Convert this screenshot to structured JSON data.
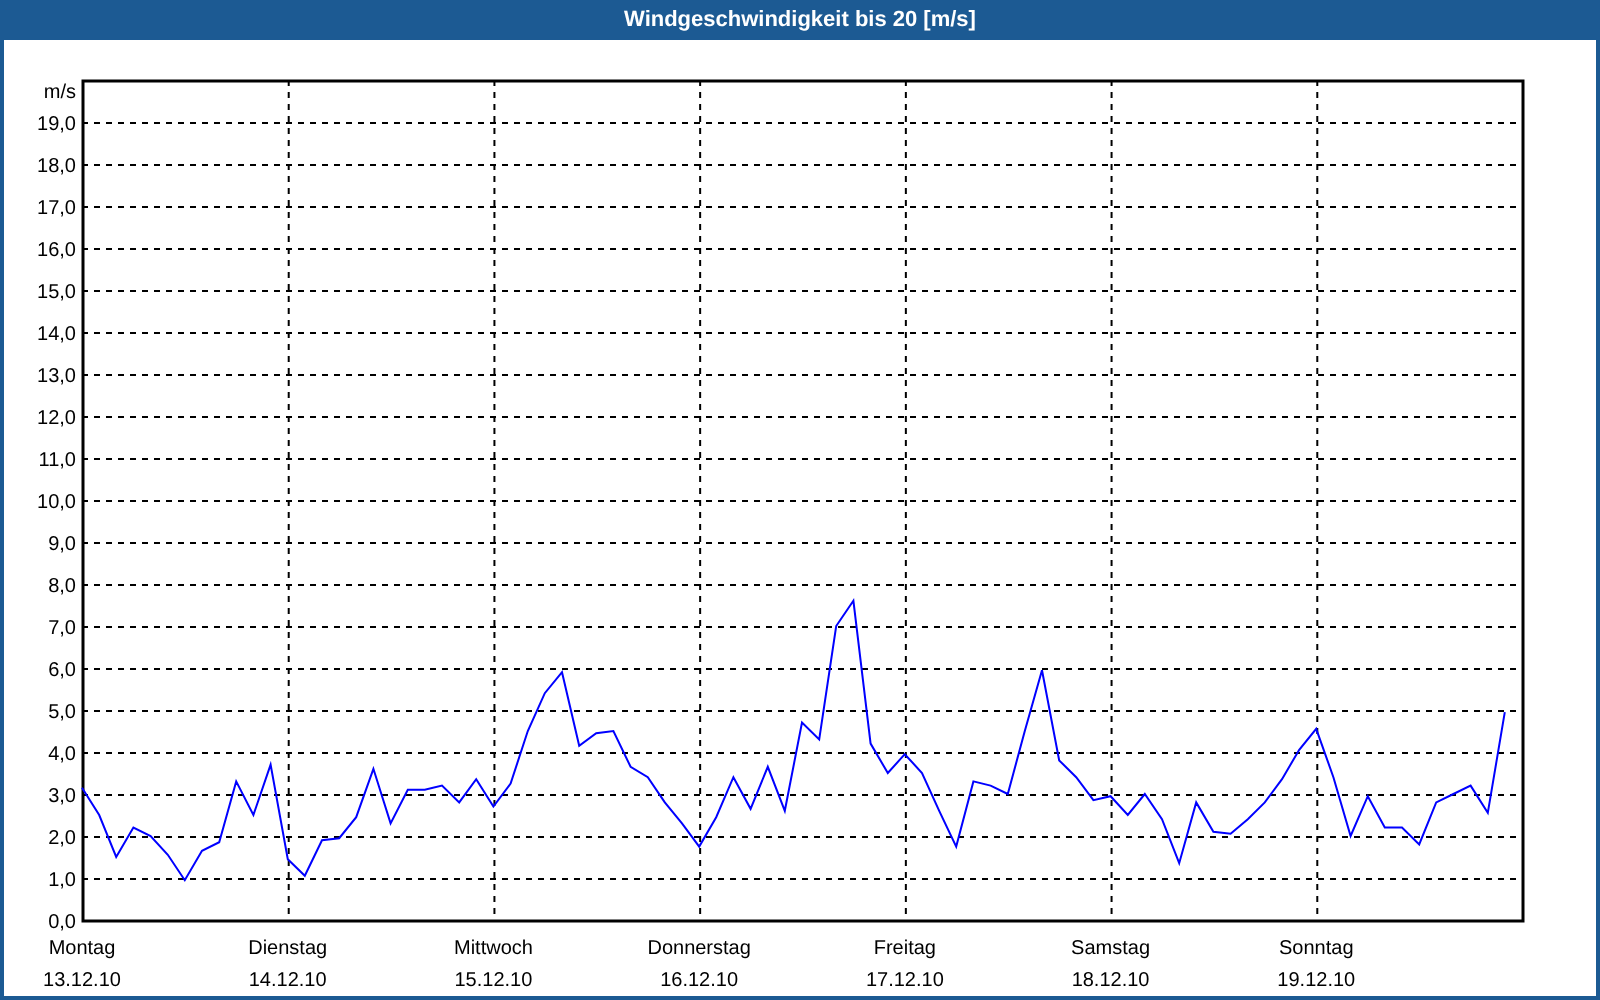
{
  "window": {
    "title": "Windgeschwindigkeit bis 20 [m/s]"
  },
  "chart": {
    "x_dates": [
      "13.12.10",
      "14.12.10",
      "15.12.10",
      "16.12.10",
      "17.12.10",
      "18.12.10",
      "19.12.10"
    ],
    "chart_data": {
      "type": "line",
      "grid": true,
      "ylabel": "m/s",
      "ylim": [
        0,
        20
      ],
      "yticks": [
        {
          "value": 0,
          "label": "0,0"
        },
        {
          "value": 1,
          "label": "1,0"
        },
        {
          "value": 2,
          "label": "2,0"
        },
        {
          "value": 3,
          "label": "3,0"
        },
        {
          "value": 4,
          "label": "4,0"
        },
        {
          "value": 5,
          "label": "5,0"
        },
        {
          "value": 6,
          "label": "6,0"
        },
        {
          "value": 7,
          "label": "7,0"
        },
        {
          "value": 8,
          "label": "8,0"
        },
        {
          "value": 9,
          "label": "9,0"
        },
        {
          "value": 10,
          "label": "10,0"
        },
        {
          "value": 11,
          "label": "11,0"
        },
        {
          "value": 12,
          "label": "12,0"
        },
        {
          "value": 13,
          "label": "13,0"
        },
        {
          "value": 14,
          "label": "14,0"
        },
        {
          "value": 15,
          "label": "15,0"
        },
        {
          "value": 16,
          "label": "16,0"
        },
        {
          "value": 17,
          "label": "17,0"
        },
        {
          "value": 18,
          "label": "18,0"
        },
        {
          "value": 19,
          "label": "19,0"
        }
      ],
      "categories": [
        "Montag",
        null,
        null,
        null,
        null,
        null,
        null,
        null,
        null,
        null,
        null,
        null,
        "Dienstag",
        null,
        null,
        null,
        null,
        null,
        null,
        null,
        null,
        null,
        null,
        null,
        "Mittwoch",
        null,
        null,
        null,
        null,
        null,
        null,
        null,
        null,
        null,
        null,
        null,
        "Donnerstag",
        null,
        null,
        null,
        null,
        null,
        null,
        null,
        null,
        null,
        null,
        null,
        "Freitag",
        null,
        null,
        null,
        null,
        null,
        null,
        null,
        null,
        null,
        null,
        null,
        "Samstag",
        null,
        null,
        null,
        null,
        null,
        null,
        null,
        null,
        null,
        null,
        null,
        "Sonntag",
        null,
        null,
        null,
        null,
        null,
        null,
        null,
        null,
        null,
        null,
        null
      ],
      "series": [
        {
          "color": "#0000ff",
          "values": [
            3.15,
            2.5,
            1.5,
            2.2,
            2.0,
            1.55,
            0.95,
            1.65,
            1.85,
            3.3,
            2.5,
            3.7,
            1.45,
            1.05,
            1.9,
            1.95,
            2.45,
            3.6,
            2.3,
            3.1,
            3.1,
            3.2,
            2.8,
            3.35,
            2.7,
            3.25,
            4.5,
            5.4,
            5.9,
            4.15,
            4.45,
            4.5,
            3.65,
            3.4,
            2.8,
            2.3,
            1.75,
            2.45,
            3.4,
            2.65,
            3.65,
            2.6,
            4.7,
            4.3,
            7.0,
            7.6,
            4.2,
            3.5,
            3.95,
            3.5,
            2.6,
            1.75,
            3.3,
            3.2,
            3.0,
            4.5,
            5.95,
            3.8,
            3.4,
            2.85,
            2.95,
            2.5,
            3.0,
            2.4,
            1.35,
            2.8,
            2.1,
            2.05,
            2.4,
            2.8,
            3.35,
            4.05,
            4.55,
            3.4,
            2.0,
            2.95,
            2.2,
            2.2,
            1.8,
            2.8,
            3.0,
            3.2,
            2.55,
            4.95
          ]
        }
      ]
    }
  }
}
